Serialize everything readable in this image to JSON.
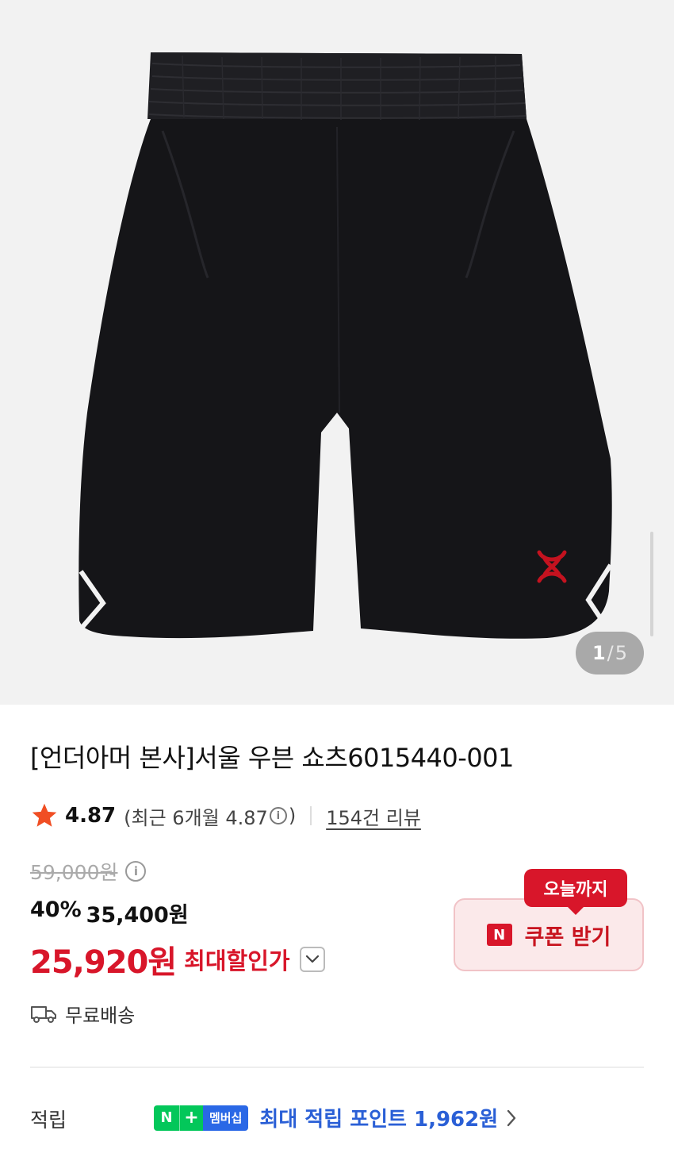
{
  "gallery": {
    "image_alt": "언더아머 우븐 쇼츠 블랙",
    "current_index": "1",
    "separator": "/",
    "total": "5"
  },
  "product": {
    "title": "[언더아머 본사]서울 우븐 쇼츠6015440-001"
  },
  "rating": {
    "score": "4.87",
    "recent_prefix": "(최근 6개월 4.87",
    "recent_suffix": ")",
    "review_count": "154건 리뷰"
  },
  "price": {
    "original": "59,000원",
    "discount_rate": "40%",
    "sale_price": "35,400원",
    "max_discount_price": "25,920원",
    "max_discount_label": "최대할인가"
  },
  "coupon": {
    "badge": "오늘까지",
    "n_mark": "N",
    "label": "쿠폰 받기"
  },
  "shipping": {
    "label": "무료배송"
  },
  "points": {
    "label": "적립",
    "badge_n": "N",
    "badge_plus": "+",
    "badge_membership": "멤버십",
    "text": "최대 적립 포인트 1,962원"
  },
  "colors": {
    "accent_red": "#d8162a",
    "points_blue": "#2a5fd6",
    "naver_green": "#03c75a",
    "star_orange": "#f04e23"
  },
  "icons": [
    "star-icon",
    "info-icon",
    "chevron-down-icon",
    "truck-icon",
    "chevron-right-icon",
    "under-armour-logo"
  ]
}
